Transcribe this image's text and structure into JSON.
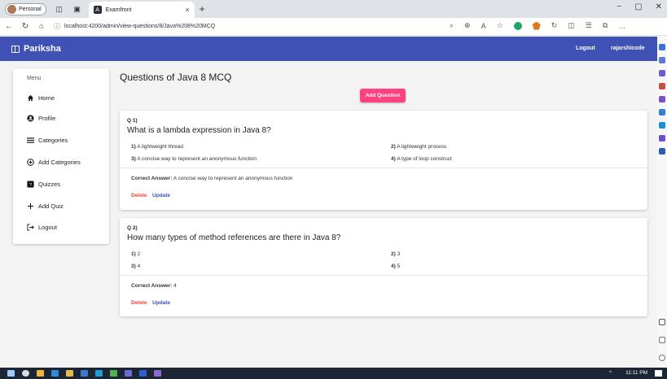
{
  "browser": {
    "profile_label": "Personal",
    "tab_title": "Examfront",
    "tab_close": "×",
    "new_tab": "+",
    "url": "localhost:4200/admin/view-questions/8/Java%208%20MCQ",
    "win_min": "−",
    "win_max": "▢",
    "win_close": "✕"
  },
  "app": {
    "brand": "Pariksha",
    "logout": "Logout",
    "username": "rajarshicode",
    "colors": {
      "header": "#3f51b5",
      "accent": "#ff4081",
      "delete": "#f44336"
    }
  },
  "sidebar": {
    "title": "Menu",
    "items": [
      {
        "label": "Home",
        "icon": "home-icon"
      },
      {
        "label": "Profile",
        "icon": "account-icon"
      },
      {
        "label": "Categories",
        "icon": "list-icon"
      },
      {
        "label": "Add Categories",
        "icon": "add-circle-icon"
      },
      {
        "label": "Quizzes",
        "icon": "quiz-icon"
      },
      {
        "label": "Add Quiz",
        "icon": "plus-icon"
      },
      {
        "label": "Logout",
        "icon": "logout-icon"
      }
    ]
  },
  "main": {
    "page_title": "Questions of Java 8 MCQ",
    "add_question": "Add Question",
    "answer_label": "Correct Answer:",
    "delete_label": "Delete",
    "update_label": "Update",
    "questions": [
      {
        "num": "Q 1)",
        "text": "What is a lambda expression in Java 8?",
        "options": [
          {
            "n": "1)",
            "text": "A lightweight thread"
          },
          {
            "n": "2)",
            "text": "A lightweight process"
          },
          {
            "n": "3)",
            "text": "A concise way to represent an anonymous function"
          },
          {
            "n": "4)",
            "text": "A type of loop construct"
          }
        ],
        "answer": "A concise way to represent an anonymous function"
      },
      {
        "num": "Q 2)",
        "text": "How many types of method references are there in Java 8?",
        "options": [
          {
            "n": "1)",
            "text": "2"
          },
          {
            "n": "2)",
            "text": "3"
          },
          {
            "n": "3)",
            "text": "4"
          },
          {
            "n": "4)",
            "text": "5"
          }
        ],
        "answer": "4"
      }
    ]
  },
  "taskbar": {
    "time": "11:11 PM",
    "tray": "^"
  }
}
